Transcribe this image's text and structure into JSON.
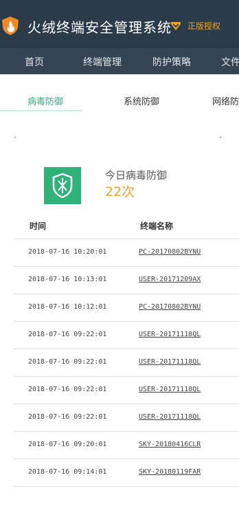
{
  "header": {
    "title": "火绒终端安全管理系统",
    "license": "正版授权",
    "logo_icon": "huorong-flame-shield-icon",
    "license_icon": "license-badge-icon",
    "colors": {
      "background": "#2b3b4a",
      "accent": "#f0a526",
      "logo": "#f08a24"
    }
  },
  "nav": {
    "items": [
      "首页",
      "终端管理",
      "防护策略",
      "文件"
    ],
    "background": "#344452"
  },
  "subtabs": {
    "items": [
      "病毒防御",
      "系统防御",
      "网络防御"
    ],
    "active": "病毒防御",
    "accent": "#31b27b"
  },
  "stat": {
    "icon": "shield-virus-defense-icon",
    "label": "今日病毒防御",
    "value": "22次"
  },
  "table": {
    "headers": [
      "时间",
      "终端名称"
    ],
    "rows": [
      {
        "time": "2018-07-16 10:20:01",
        "name": "PC-20170802BYNU"
      },
      {
        "time": "2018-07-16 10:13:01",
        "name": "USER-20171209AX"
      },
      {
        "time": "2018-07-16 10:12:01",
        "name": "PC-20170802BYNU"
      },
      {
        "time": "2018-07-16 09:22:01",
        "name": "USER-20171118QL"
      },
      {
        "time": "2018-07-16 09:22:01",
        "name": "USER-20171118QL"
      },
      {
        "time": "2018-07-16 09:22:01",
        "name": "USER-20171118QL"
      },
      {
        "time": "2018-07-16 09:22:01",
        "name": "USER-20171118QL"
      },
      {
        "time": "2018-07-16 09:20:01",
        "name": "SKY-20180416CLR"
      },
      {
        "time": "2018-07-16 09:14:01",
        "name": "SKY-20180119FAR"
      }
    ]
  }
}
